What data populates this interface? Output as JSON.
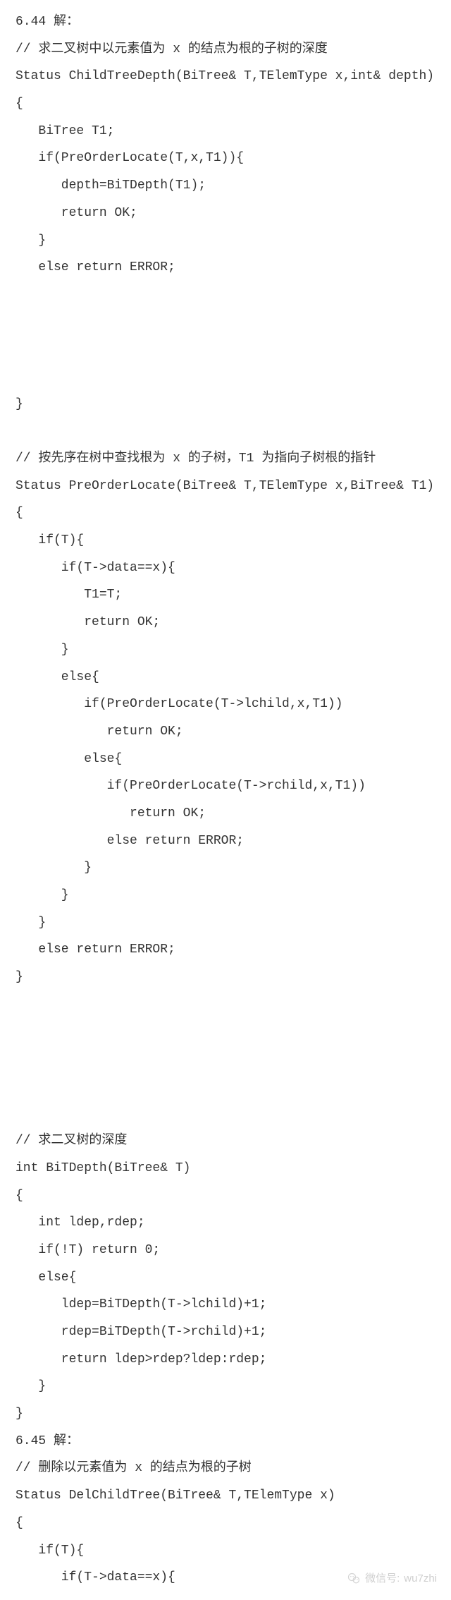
{
  "lines": [
    "6.44 解：",
    "// 求二叉树中以元素值为 x 的结点为根的子树的深度",
    "Status ChildTreeDepth(BiTree& T,TElemType x,int& depth)",
    "{",
    "   BiTree T1;",
    "   if(PreOrderLocate(T,x,T1)){",
    "      depth=BiTDepth(T1);",
    "      return OK;",
    "   }",
    "   else return ERROR;",
    "",
    "",
    "",
    "",
    "}",
    "",
    "// 按先序在树中查找根为 x 的子树，T1 为指向子树根的指针",
    "Status PreOrderLocate(BiTree& T,TElemType x,BiTree& T1)",
    "{",
    "   if(T){",
    "      if(T->data==x){",
    "         T1=T;",
    "         return OK;",
    "      }",
    "      else{",
    "         if(PreOrderLocate(T->lchild,x,T1))",
    "            return OK;",
    "         else{",
    "            if(PreOrderLocate(T->rchild,x,T1))",
    "               return OK;",
    "            else return ERROR;",
    "         }",
    "      }",
    "   }",
    "   else return ERROR;",
    "}",
    "",
    "",
    "",
    "",
    "",
    "// 求二叉树的深度",
    "int BiTDepth(BiTree& T)",
    "{",
    "   int ldep,rdep;",
    "   if(!T) return 0;",
    "   else{",
    "      ldep=BiTDepth(T->lchild)+1;",
    "      rdep=BiTDepth(T->rchild)+1;",
    "      return ldep>rdep?ldep:rdep;",
    "   }",
    "}",
    "6.45 解：",
    "// 删除以元素值为 x 的结点为根的子树",
    "Status DelChildTree(BiTree& T,TElemType x)",
    "{",
    "   if(T){",
    "      if(T->data==x){"
  ],
  "watermark": {
    "label": "微信号:",
    "id": "wu7zhi"
  }
}
